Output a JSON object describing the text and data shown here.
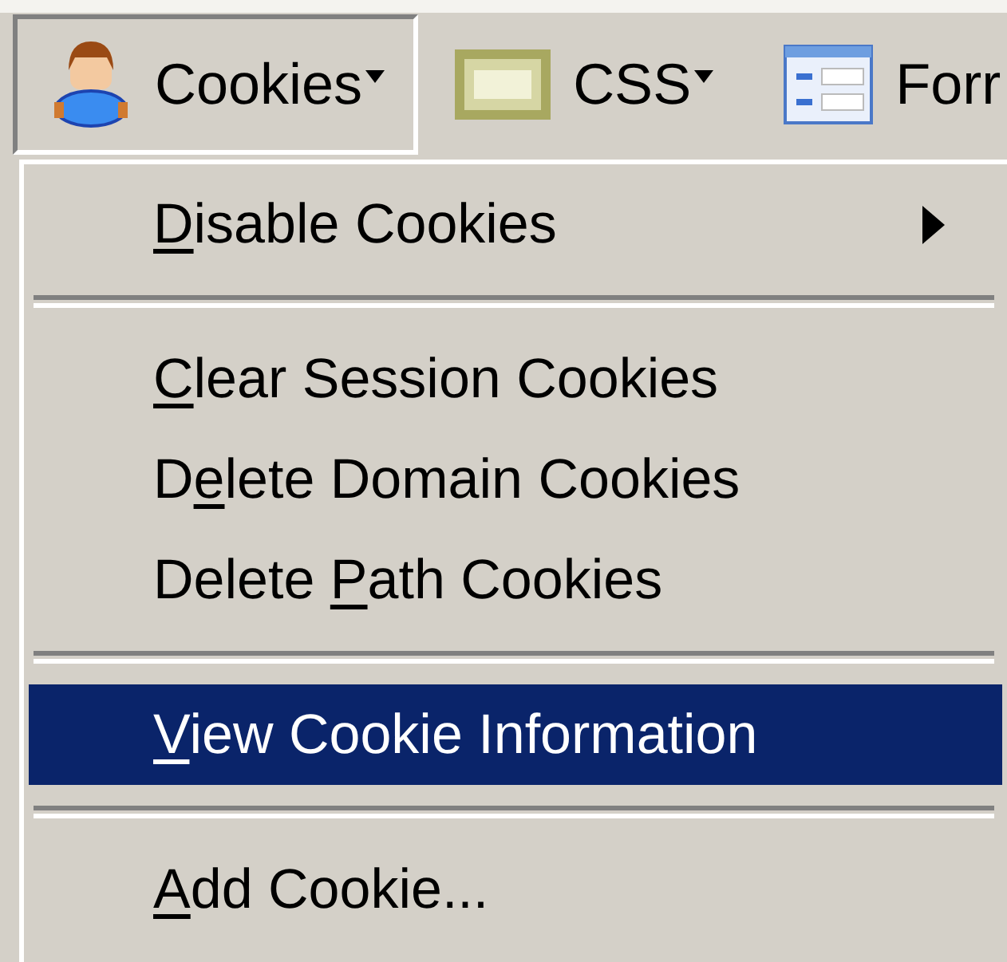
{
  "toolbar": {
    "buttons": [
      {
        "label": "Cookies",
        "pressed": true,
        "dropdown": true
      },
      {
        "label": "CSS",
        "pressed": false,
        "dropdown": true
      },
      {
        "label": "Forr",
        "pressed": false,
        "dropdown": false
      }
    ]
  },
  "menu": {
    "items": [
      {
        "kind": "item",
        "key": "D",
        "after": "isable Cookies",
        "submenu": true,
        "selected": false
      },
      {
        "kind": "separator"
      },
      {
        "kind": "item",
        "key": "C",
        "after": "lear Session Cookies",
        "submenu": false,
        "selected": false
      },
      {
        "kind": "item",
        "before": "D",
        "key": "e",
        "after": "lete Domain Cookies",
        "submenu": false,
        "selected": false
      },
      {
        "kind": "item",
        "before": "Delete ",
        "key": "P",
        "after": "ath Cookies",
        "submenu": false,
        "selected": false
      },
      {
        "kind": "separator"
      },
      {
        "kind": "item",
        "key": "V",
        "after": "iew Cookie Information",
        "submenu": false,
        "selected": true
      },
      {
        "kind": "separator"
      },
      {
        "kind": "item",
        "key": "A",
        "after": "dd Cookie...",
        "submenu": false,
        "selected": false
      }
    ]
  }
}
